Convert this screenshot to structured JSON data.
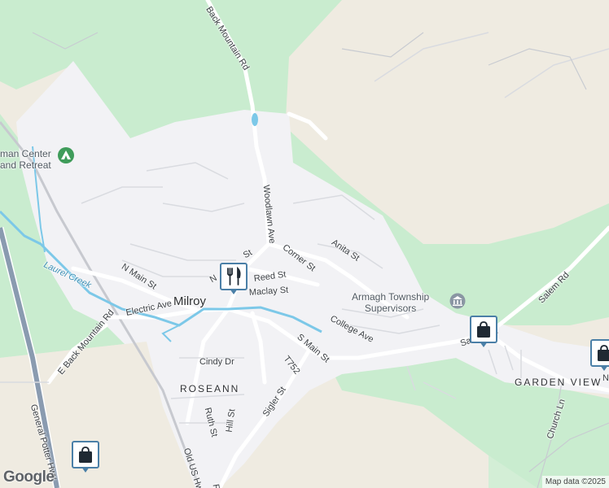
{
  "map": {
    "roads": {
      "back_mountain_rd": "Back Mountain Rd",
      "woodlawn_ave": "Woodlawn Ave",
      "corner_st": "Corner St",
      "anita_st": "Anita St",
      "n_main_st": "N Main St",
      "n_st_fragment": "N",
      "st_fragment": "St",
      "reed_st": "Reed St",
      "maclay_st": "Maclay St",
      "electric_ave": "Electric Ave",
      "e_back_mountain_rd": "E Back Mountain Rd",
      "college_ave": "College Ave",
      "s_main_st": "S Main St",
      "t752": "T752",
      "cindy_dr": "Cindy Dr",
      "ruth_st": "Ruth St",
      "hill_st": "Hill St",
      "sigler_st": "Sigler St",
      "old_us_hwy": "Old US Hwy",
      "general_potter_hwy": "General Potter Hwy",
      "church_ln": "Church Ln",
      "salem_rd": "Salem Rd",
      "salem_rd_lower": "Salem Rd",
      "n_fragment_right": "N",
      "rt_fragment": "R"
    },
    "places": {
      "milroy": "Milroy",
      "roseann": "ROSEANN",
      "garden_view": "GARDEN VIEW"
    },
    "water": {
      "laurel_creek": "Laurel Creek"
    },
    "pois": {
      "retreat_line1": "man Center",
      "retreat_line2": "and Retreat",
      "township_line1": "Armagh Township",
      "township_line2": "Supervisors"
    },
    "icons": {
      "restaurant": "restaurant-icon",
      "shopping": "shopping-bag-icon",
      "campground": "campground-icon",
      "government": "government-building-icon"
    },
    "attribution": "Map data ©2025",
    "logo": "Google"
  },
  "colors": {
    "forest": "#c9eccf",
    "land": "#efebe1",
    "urban": "#f1f1f4",
    "water": "#7cc8e8",
    "highway": "#8a9bb0",
    "pin_border": "#4a7fa7"
  }
}
